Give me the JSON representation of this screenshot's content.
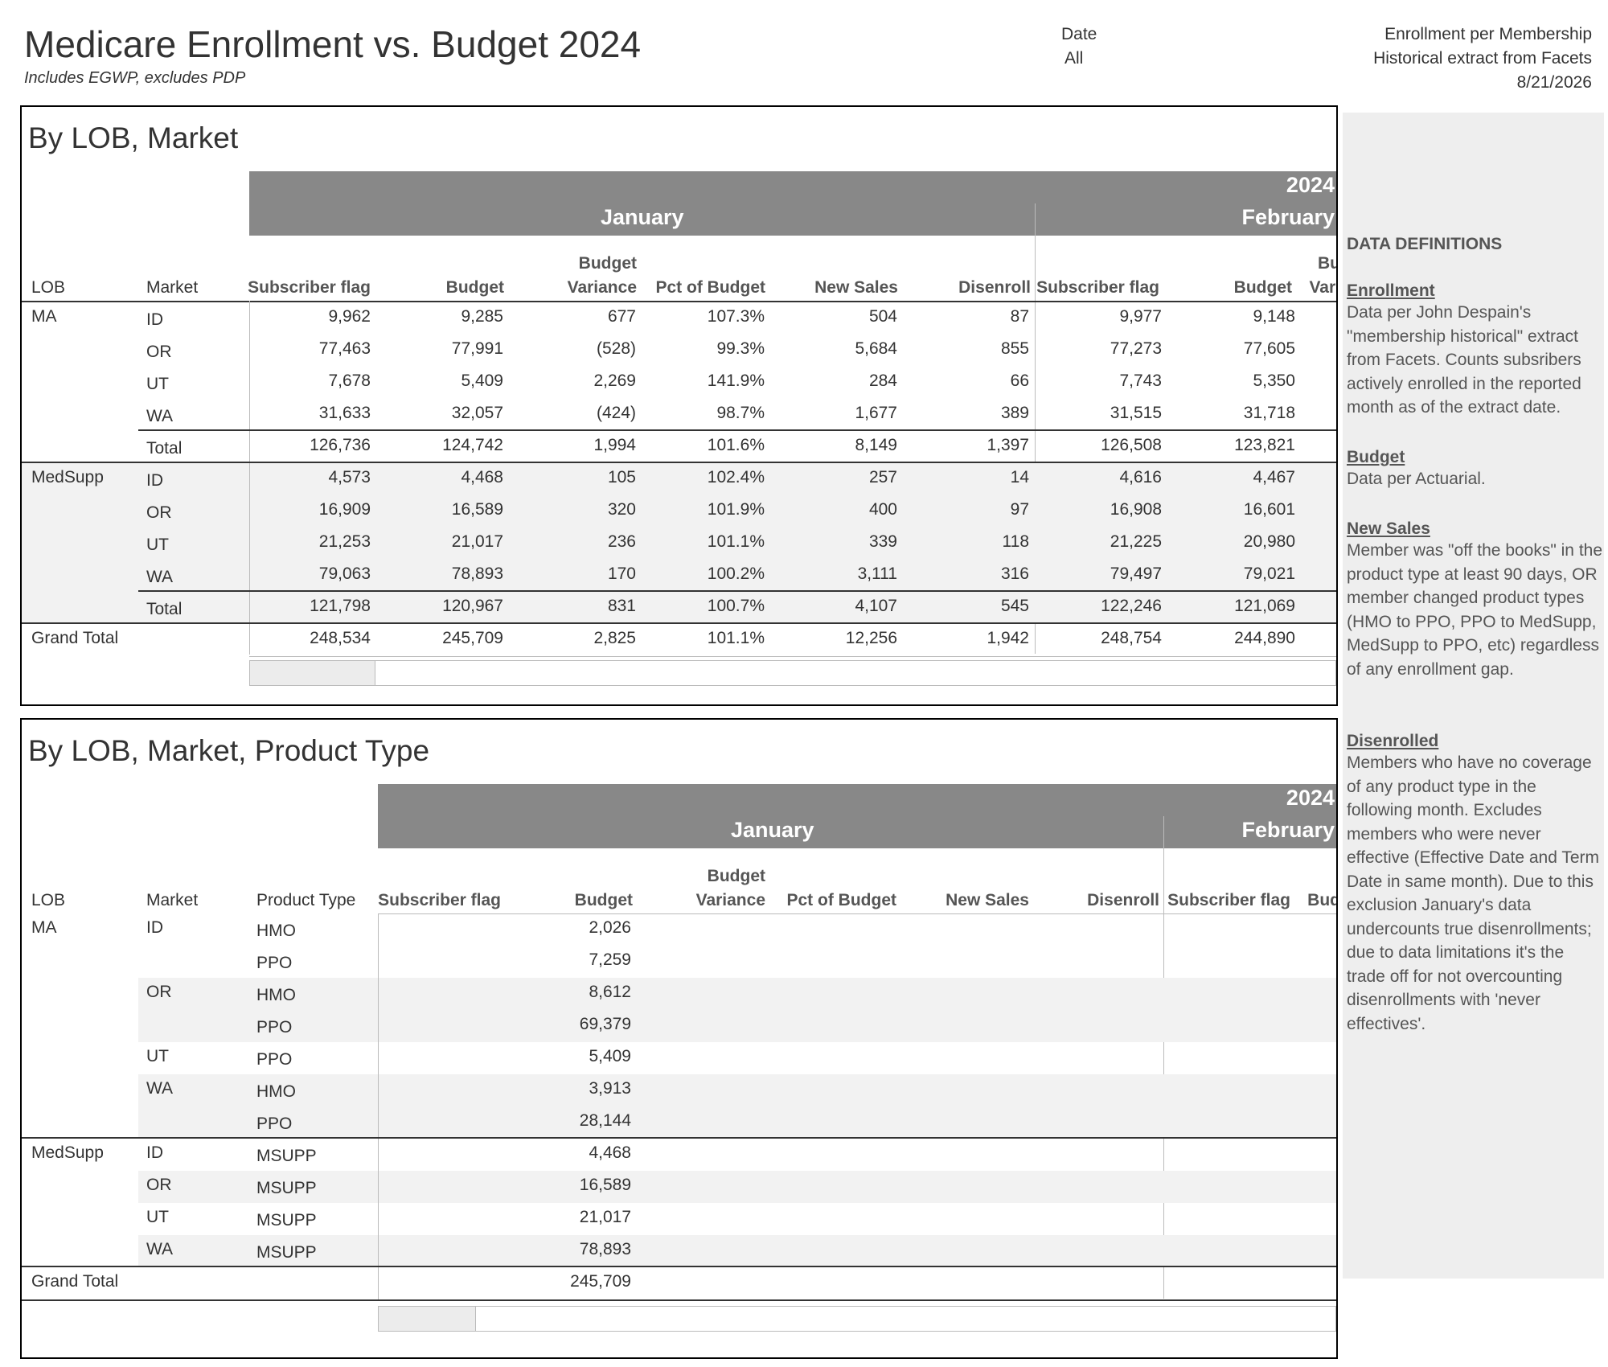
{
  "header": {
    "title": "Medicare Enrollment vs. Budget 2024",
    "subtitle": "Includes EGWP, excludes PDP",
    "date_filter_label": "Date",
    "date_filter_value": "All",
    "source_line1": "Enrollment per Membership",
    "source_line2": "Historical extract from Facets",
    "source_date": "8/21/2026"
  },
  "table1": {
    "title": "By LOB, Market",
    "year": "2024",
    "months": [
      "January",
      "February"
    ],
    "row_headers": [
      "LOB",
      "Market"
    ],
    "columns": [
      "Subscriber flag",
      "Budget",
      "Budget",
      "Variance",
      "Pct of Budget",
      "New Sales",
      "Disenroll",
      "Subscriber flag",
      "Budget",
      "Bu",
      "Vari"
    ],
    "rows": [
      {
        "lob": "MA",
        "market": "ID",
        "v": [
          "9,962",
          "9,285",
          "677",
          "107.3%",
          "504",
          "87",
          "9,977",
          "9,148"
        ]
      },
      {
        "lob": "",
        "market": "OR",
        "v": [
          "77,463",
          "77,991",
          "(528)",
          "99.3%",
          "5,684",
          "855",
          "77,273",
          "77,605"
        ]
      },
      {
        "lob": "",
        "market": "UT",
        "v": [
          "7,678",
          "5,409",
          "2,269",
          "141.9%",
          "284",
          "66",
          "7,743",
          "5,350"
        ]
      },
      {
        "lob": "",
        "market": "WA",
        "v": [
          "31,633",
          "32,057",
          "(424)",
          "98.7%",
          "1,677",
          "389",
          "31,515",
          "31,718"
        ]
      },
      {
        "lob": "",
        "market": "Total",
        "v": [
          "126,736",
          "124,742",
          "1,994",
          "101.6%",
          "8,149",
          "1,397",
          "126,508",
          "123,821"
        ]
      },
      {
        "lob": "MedSupp",
        "market": "ID",
        "v": [
          "4,573",
          "4,468",
          "105",
          "102.4%",
          "257",
          "14",
          "4,616",
          "4,467"
        ]
      },
      {
        "lob": "",
        "market": "OR",
        "v": [
          "16,909",
          "16,589",
          "320",
          "101.9%",
          "400",
          "97",
          "16,908",
          "16,601"
        ]
      },
      {
        "lob": "",
        "market": "UT",
        "v": [
          "21,253",
          "21,017",
          "236",
          "101.1%",
          "339",
          "118",
          "21,225",
          "20,980"
        ]
      },
      {
        "lob": "",
        "market": "WA",
        "v": [
          "79,063",
          "78,893",
          "170",
          "100.2%",
          "3,111",
          "316",
          "79,497",
          "79,021"
        ]
      },
      {
        "lob": "",
        "market": "Total",
        "v": [
          "121,798",
          "120,967",
          "831",
          "100.7%",
          "4,107",
          "545",
          "122,246",
          "121,069"
        ]
      },
      {
        "lob": "Grand Total",
        "market": "",
        "v": [
          "248,534",
          "245,709",
          "2,825",
          "101.1%",
          "12,256",
          "1,942",
          "248,754",
          "244,890"
        ]
      }
    ]
  },
  "table2": {
    "title": "By LOB, Market, Product Type",
    "year": "2024",
    "months": [
      "January",
      "February"
    ],
    "row_headers": [
      "LOB",
      "Market",
      "Product Type"
    ],
    "columns": [
      "Subscriber flag",
      "Budget",
      "Budget",
      "Variance",
      "Pct of Budget",
      "New Sales",
      "Disenroll",
      "Subscriber flag",
      "Bud"
    ],
    "rows": [
      {
        "lob": "MA",
        "market": "ID",
        "product": "HMO",
        "budget": "2,026"
      },
      {
        "lob": "",
        "market": "",
        "product": "PPO",
        "budget": "7,259"
      },
      {
        "lob": "",
        "market": "OR",
        "product": "HMO",
        "budget": "8,612"
      },
      {
        "lob": "",
        "market": "",
        "product": "PPO",
        "budget": "69,379"
      },
      {
        "lob": "",
        "market": "UT",
        "product": "PPO",
        "budget": "5,409"
      },
      {
        "lob": "",
        "market": "WA",
        "product": "HMO",
        "budget": "3,913"
      },
      {
        "lob": "",
        "market": "",
        "product": "PPO",
        "budget": "28,144"
      },
      {
        "lob": "MedSupp",
        "market": "ID",
        "product": "MSUPP",
        "budget": "4,468"
      },
      {
        "lob": "",
        "market": "OR",
        "product": "MSUPP",
        "budget": "16,589"
      },
      {
        "lob": "",
        "market": "UT",
        "product": "MSUPP",
        "budget": "21,017"
      },
      {
        "lob": "",
        "market": "WA",
        "product": "MSUPP",
        "budget": "78,893"
      },
      {
        "lob": "Grand Total",
        "market": "",
        "product": "",
        "budget": "245,709"
      }
    ]
  },
  "definitions": {
    "title": "DATA DEFINITIONS",
    "items": [
      {
        "term": "Enrollment",
        "text": "Data per John Despain's \"membership historical\" extract from Facets. Counts subsribers actively enrolled in the reported month as of the extract date."
      },
      {
        "term": "Budget",
        "text": "Data per Actuarial."
      },
      {
        "term": "New Sales",
        "text": "Member was \"off the books\" in the product type at least 90 days, OR member changed product types (HMO to PPO, PPO to MedSupp, MedSupp to PPO, etc) regardless of any enrollment gap."
      },
      {
        "term": "Disenrolled",
        "text": "Members who have no coverage of any product type in the following month. Excludes members who were never effective (Effective Date and Term Date in same month). Due to this exclusion January's data undercounts true disenrollments; due to data limitations it's the trade off for not overcounting disenrollments with 'never effectives'."
      }
    ]
  }
}
